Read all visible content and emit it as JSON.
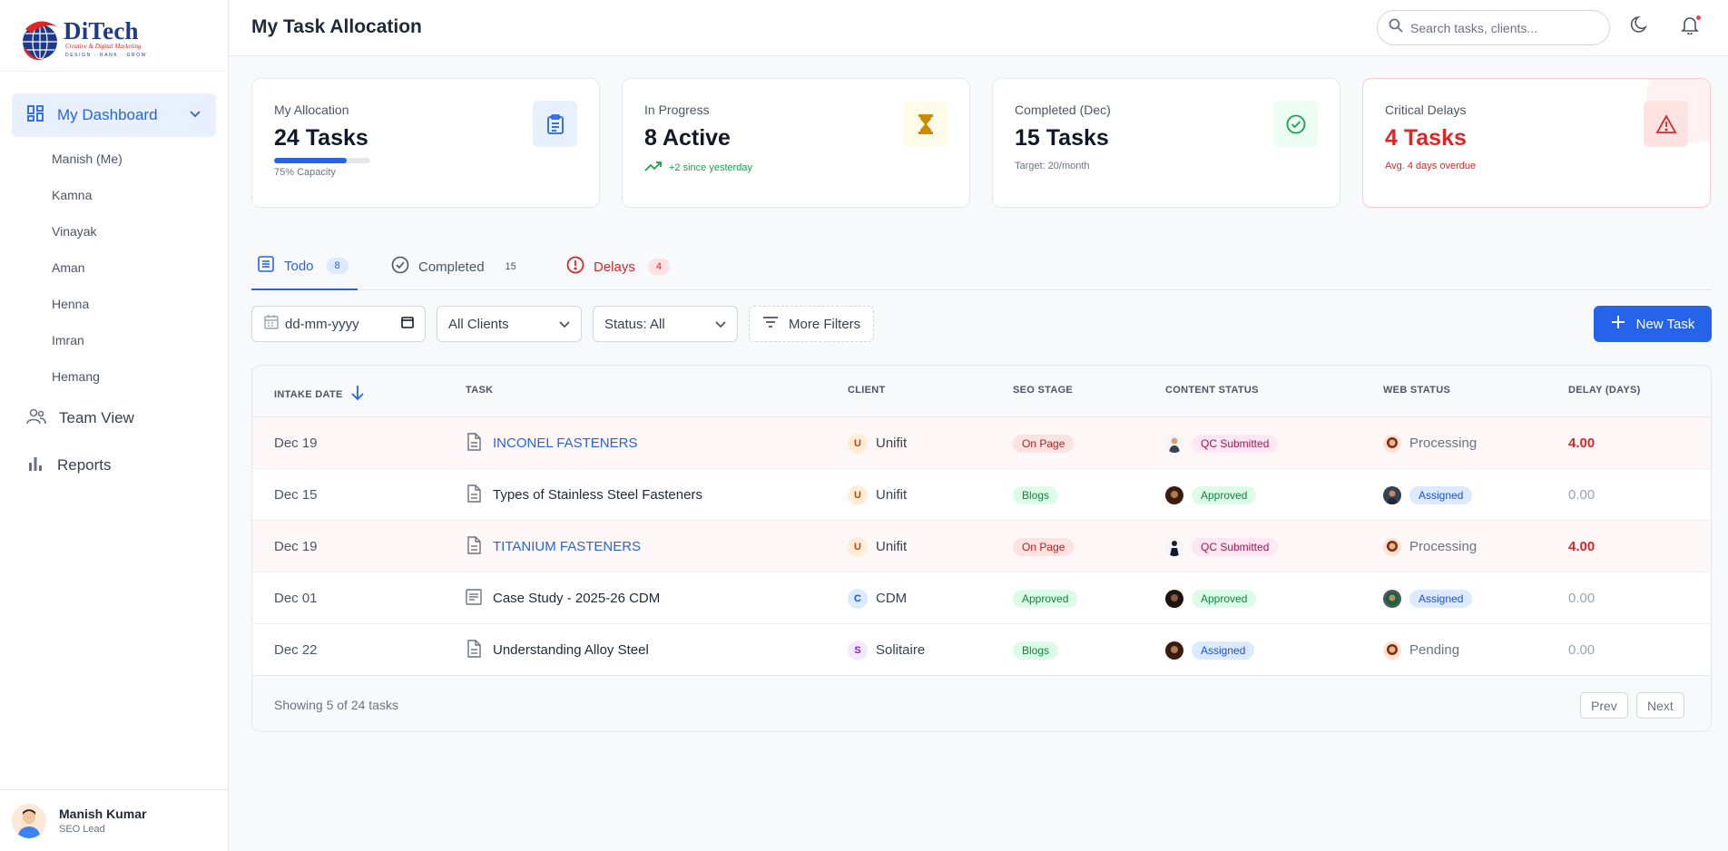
{
  "brand": {
    "name": "DiTech",
    "tagline": "Creative & Digital Marketing",
    "subline": "DESIGN · RANK · GROW"
  },
  "sidebar": {
    "main": "My Dashboard",
    "sub_items": [
      "Manish (Me)",
      "Kamna",
      "Vinayak",
      "Aman",
      "Henna",
      "Imran",
      "Hemang"
    ],
    "items": [
      "Team View",
      "Reports"
    ]
  },
  "user": {
    "name": "Manish Kumar",
    "role": "SEO Lead"
  },
  "header": {
    "title": "My Task Allocation",
    "search_placeholder": "Search tasks, clients..."
  },
  "cards": [
    {
      "label": "My Allocation",
      "value": "24 Tasks",
      "sub": "75% Capacity",
      "progress": 0.75,
      "icon": "clipboard-icon"
    },
    {
      "label": "In Progress",
      "value": "8 Active",
      "sub": "+2 since yesterday",
      "icon": "hourglass-icon"
    },
    {
      "label": "Completed (Dec)",
      "value": "15 Tasks",
      "sub": "Target: 20/month",
      "icon": "check-circle-icon"
    },
    {
      "label": "Critical Delays",
      "value": "4 Tasks",
      "sub": "Avg. 4 days overdue",
      "icon": "warning-icon"
    }
  ],
  "tabs": [
    {
      "label": "Todo",
      "count": "8"
    },
    {
      "label": "Completed",
      "count": "15"
    },
    {
      "label": "Delays",
      "count": "4"
    }
  ],
  "filters": {
    "date_placeholder": "dd-mm-yyyy",
    "clients": "All Clients",
    "status": "Status: All",
    "more": "More Filters",
    "new_task": "New Task"
  },
  "table": {
    "headers": [
      "INTAKE DATE",
      "TASK",
      "CLIENT",
      "SEO STAGE",
      "CONTENT STATUS",
      "WEB STATUS",
      "DELAY (DAYS)"
    ],
    "rows": [
      {
        "date": "Dec 19",
        "task": "INCONEL FASTENERS",
        "client_initial": "U",
        "client": "Unifit",
        "seo": "On Page",
        "content": "QC Submitted",
        "web": "Processing",
        "delay": "4.00"
      },
      {
        "date": "Dec 15",
        "task": "Types of Stainless Steel Fasteners",
        "client_initial": "U",
        "client": "Unifit",
        "seo": "Blogs",
        "content": "Approved",
        "web": "Assigned",
        "delay": "0.00"
      },
      {
        "date": "Dec 19",
        "task": "TITANIUM FASTENERS",
        "client_initial": "U",
        "client": "Unifit",
        "seo": "On Page",
        "content": "QC Submitted",
        "web": "Processing",
        "delay": "4.00"
      },
      {
        "date": "Dec 01",
        "task": "Case Study - 2025-26 CDM",
        "client_initial": "C",
        "client": "CDM",
        "seo": "Approved",
        "content": "Approved",
        "web": "Assigned",
        "delay": "0.00"
      },
      {
        "date": "Dec 22",
        "task": "Understanding Alloy Steel",
        "client_initial": "S",
        "client": "Solitaire",
        "seo": "Blogs",
        "content": "Assigned",
        "web": "Pending",
        "delay": "0.00"
      }
    ],
    "footer": "Showing 5 of 24 tasks",
    "prev": "Prev",
    "next": "Next"
  }
}
